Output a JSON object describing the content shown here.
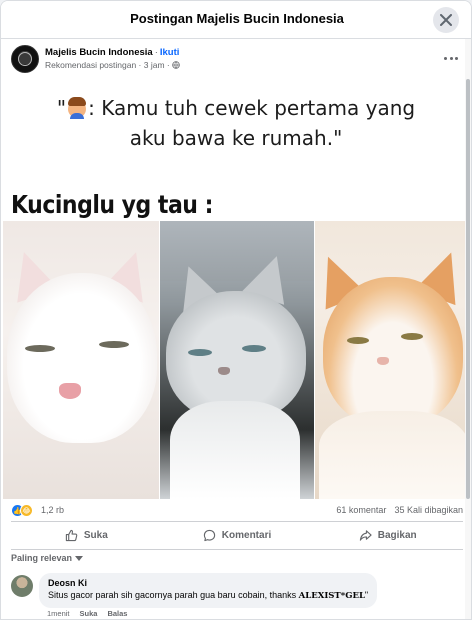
{
  "modal": {
    "title": "Postingan Majelis Bucin Indonesia"
  },
  "post": {
    "page_name": "Majelis Bucin Indonesia",
    "separator": "·",
    "follow_label": "Ikuti",
    "meta": "Rekomendasi postingan · 3 jam ·"
  },
  "image": {
    "quote_open": "\"",
    "quote_line1": ": Kamu tuh cewek pertama yang",
    "quote_line2": "aku bawa ke rumah.\"",
    "caption": "Kucinglu yg tau :"
  },
  "stats": {
    "reactions": "1,2 rb",
    "comments": "61 komentar",
    "shares": "35 Kali dibagikan"
  },
  "actions": {
    "like": "Suka",
    "comment": "Komentari",
    "share": "Bagikan"
  },
  "sort": {
    "label": "Paling relevan"
  },
  "comment": {
    "author": "Deosn Ki",
    "text": "Situs gacor parah sih gacornya parah gua baru cobain, thanks ",
    "highlight": "ALEXIST*GEL",
    "closing": "\"",
    "time": "1menit",
    "like": "Suka",
    "reply": "Balas"
  },
  "colors": {
    "accent": "#0866ff",
    "secondary_text": "#65676b",
    "like_blue": "#1877f2",
    "haha_yellow": "#f7b928"
  }
}
